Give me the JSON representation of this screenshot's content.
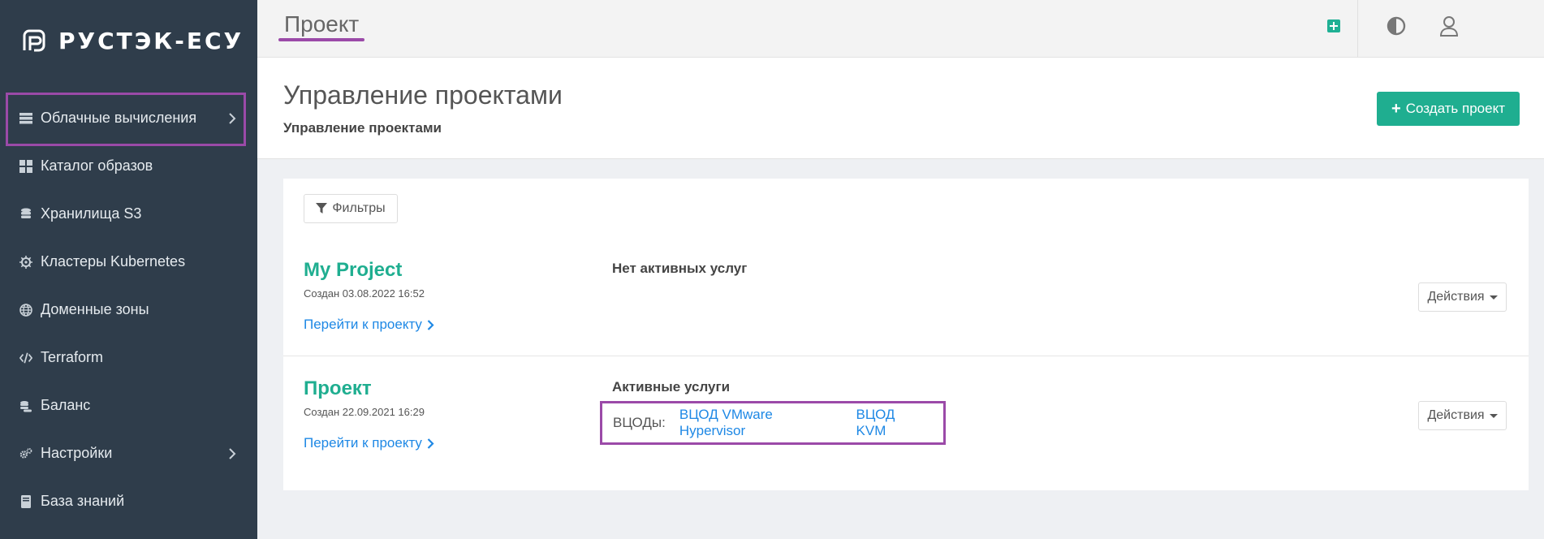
{
  "brand": {
    "name": "РУСТЭК-ЕСУ"
  },
  "sidebar": {
    "items": [
      {
        "label": "Облачные вычисления",
        "icon": "server-icon",
        "has_submenu": true,
        "highlighted": true
      },
      {
        "label": "Каталог образов",
        "icon": "grid-icon",
        "has_submenu": false
      },
      {
        "label": "Хранилища S3",
        "icon": "database-icon",
        "has_submenu": false
      },
      {
        "label": "Кластеры Kubernetes",
        "icon": "helm-icon",
        "has_submenu": false
      },
      {
        "label": "Доменные зоны",
        "icon": "globe-icon",
        "has_submenu": false
      },
      {
        "label": "Terraform",
        "icon": "code-icon",
        "has_submenu": false
      },
      {
        "label": "Баланс",
        "icon": "coins-icon",
        "has_submenu": false
      },
      {
        "label": "Настройки",
        "icon": "gears-icon",
        "has_submenu": true
      },
      {
        "label": "База знаний",
        "icon": "book-icon",
        "has_submenu": false
      }
    ]
  },
  "topbar": {
    "title": "Проект"
  },
  "header": {
    "title": "Управление проектами",
    "breadcrumb": "Управление проектами",
    "create_button": "Создать проект"
  },
  "filters": {
    "label": "Фильтры"
  },
  "projects": [
    {
      "name": "My Project",
      "created": "Создан 03.08.2022 16:52",
      "link": "Перейти к проекту",
      "status": "Нет активных услуг",
      "actions": "Действия"
    },
    {
      "name": "Проект",
      "created": "Создан 22.09.2021 16:29",
      "link": "Перейти к проекту",
      "status": "Активные услуги",
      "services_label": "ВЦОДы:",
      "services": [
        "ВЦОД VMware Hypervisor",
        "ВЦОД KVM"
      ],
      "actions": "Действия"
    }
  ],
  "colors": {
    "sidebar_bg": "#2f3d4b",
    "accent_green": "#1fae90",
    "link_blue": "#1e88e5",
    "highlight_purple": "#9b4aa8"
  }
}
